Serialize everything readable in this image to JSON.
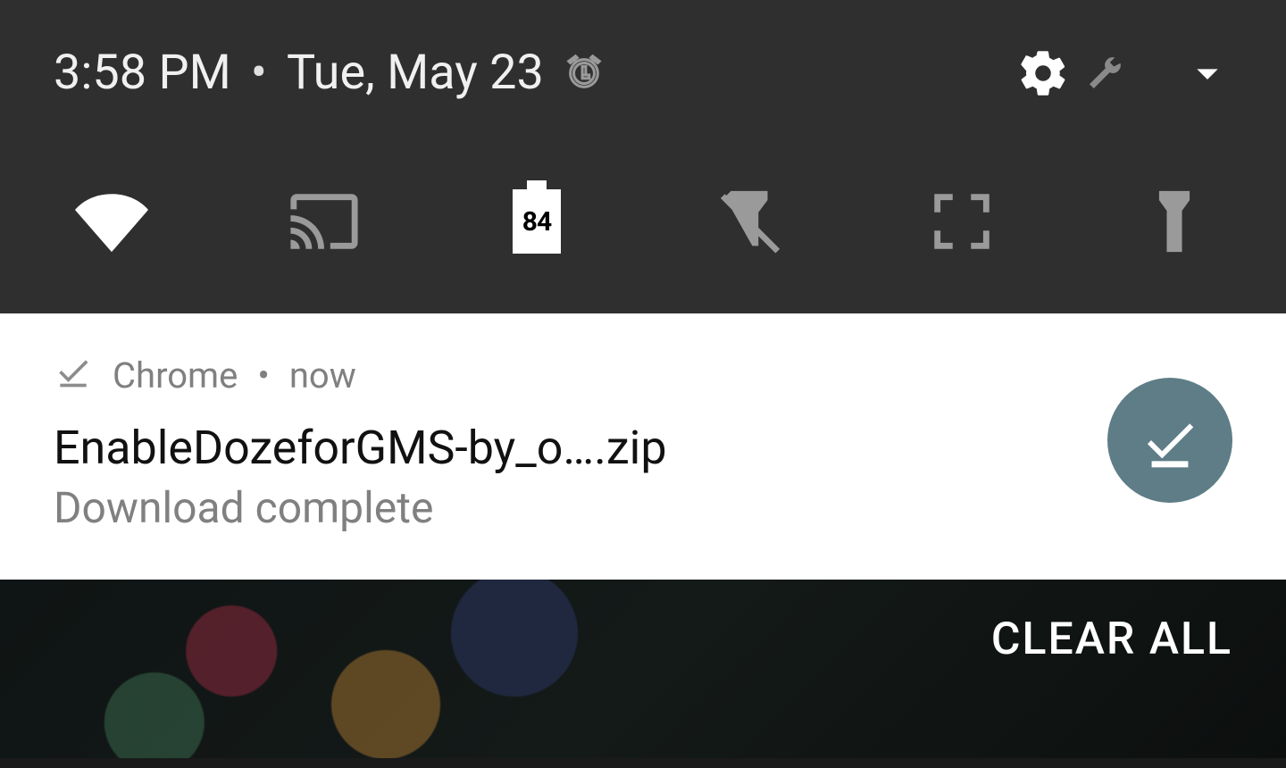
{
  "status": {
    "time": "3:58 PM",
    "date": "Tue, May 23",
    "alarm_set": true
  },
  "quick_settings": {
    "battery_percent": "84"
  },
  "notification": {
    "app": "Chrome",
    "when": "now",
    "title": "EnableDozeforGMS-by_o….zip",
    "subtitle": "Download complete"
  },
  "footer": {
    "clear_all_label": "CLEAR ALL"
  }
}
